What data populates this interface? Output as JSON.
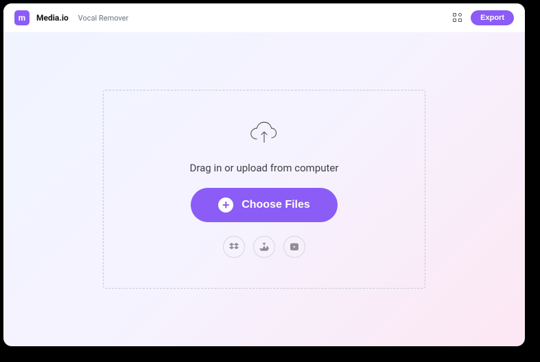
{
  "header": {
    "logo_text": "m",
    "brand": "Media.io",
    "page": "Vocal Remover",
    "export_label": "Export"
  },
  "dropzone": {
    "instruction": "Drag in or upload from computer",
    "choose_label": "Choose Files"
  },
  "sources": {
    "dropbox": "dropbox",
    "gdrive": "google-drive",
    "youtube": "youtube"
  }
}
